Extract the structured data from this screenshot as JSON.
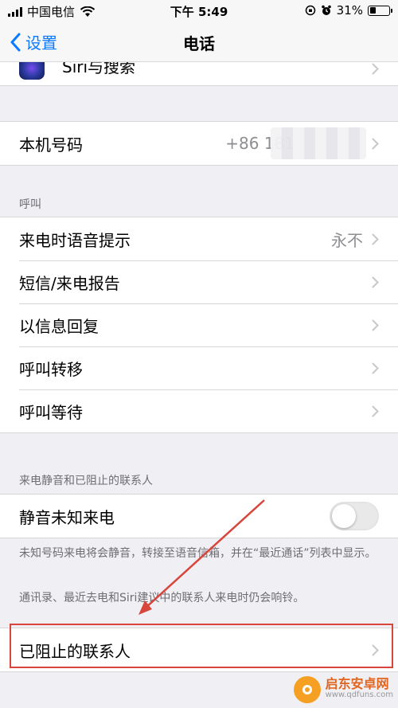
{
  "status_bar": {
    "carrier": "中国电信",
    "time": "下午 5:49",
    "battery_percent": "31%",
    "battery_level": 0.31
  },
  "nav": {
    "back_label": "设置",
    "title": "电话"
  },
  "siri_row": {
    "label": "Siri与搜索"
  },
  "phone_number": {
    "label": "本机号码",
    "value": "+86 181"
  },
  "calls_section": {
    "header": "呼叫",
    "rows": [
      {
        "label": "来电时语音提示",
        "value": "永不"
      },
      {
        "label": "短信/来电报告"
      },
      {
        "label": "以信息回复"
      },
      {
        "label": "呼叫转移"
      },
      {
        "label": "呼叫等待"
      }
    ]
  },
  "silence_section": {
    "header": "来电静音和已阻止的联系人",
    "silence_unknown": {
      "label": "静音未知来电",
      "enabled": false
    },
    "footnote_1": "未知号码来电将会静音，转接至语音信箱，并在“最近通话”列表中显示。",
    "footnote_2": "通讯录、最近去电和Siri建议中的联系人来电时仍会响铃。"
  },
  "blocked_contacts": {
    "label": "已阻止的联系人"
  },
  "colors": {
    "accent": "#0a7aff",
    "annotation": "#d8453b",
    "background": "#efeff4"
  },
  "watermark": {
    "title": "启东安卓网",
    "url": "www.qdfuns.com"
  }
}
